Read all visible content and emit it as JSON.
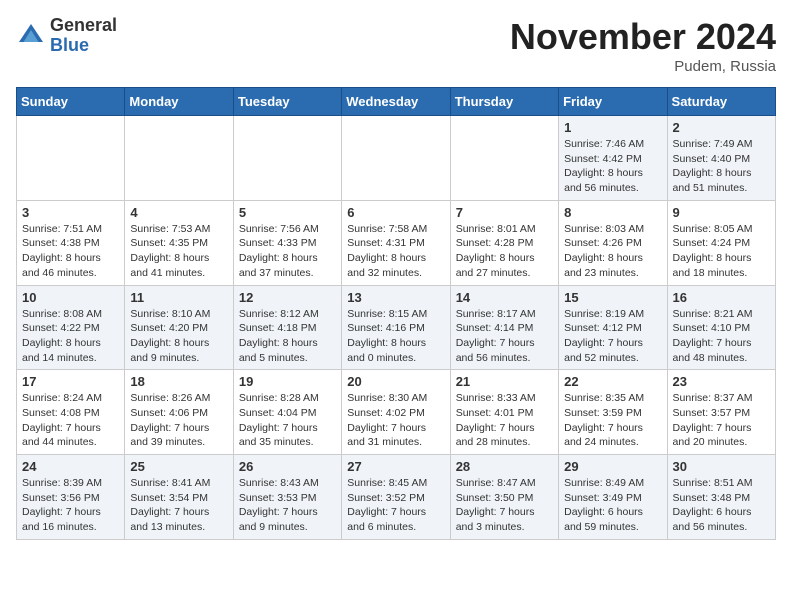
{
  "logo": {
    "general": "General",
    "blue": "Blue"
  },
  "title": "November 2024",
  "location": "Pudem, Russia",
  "days_of_week": [
    "Sunday",
    "Monday",
    "Tuesday",
    "Wednesday",
    "Thursday",
    "Friday",
    "Saturday"
  ],
  "weeks": [
    [
      {
        "day": "",
        "info": ""
      },
      {
        "day": "",
        "info": ""
      },
      {
        "day": "",
        "info": ""
      },
      {
        "day": "",
        "info": ""
      },
      {
        "day": "",
        "info": ""
      },
      {
        "day": "1",
        "info": "Sunrise: 7:46 AM\nSunset: 4:42 PM\nDaylight: 8 hours and 56 minutes."
      },
      {
        "day": "2",
        "info": "Sunrise: 7:49 AM\nSunset: 4:40 PM\nDaylight: 8 hours and 51 minutes."
      }
    ],
    [
      {
        "day": "3",
        "info": "Sunrise: 7:51 AM\nSunset: 4:38 PM\nDaylight: 8 hours and 46 minutes."
      },
      {
        "day": "4",
        "info": "Sunrise: 7:53 AM\nSunset: 4:35 PM\nDaylight: 8 hours and 41 minutes."
      },
      {
        "day": "5",
        "info": "Sunrise: 7:56 AM\nSunset: 4:33 PM\nDaylight: 8 hours and 37 minutes."
      },
      {
        "day": "6",
        "info": "Sunrise: 7:58 AM\nSunset: 4:31 PM\nDaylight: 8 hours and 32 minutes."
      },
      {
        "day": "7",
        "info": "Sunrise: 8:01 AM\nSunset: 4:28 PM\nDaylight: 8 hours and 27 minutes."
      },
      {
        "day": "8",
        "info": "Sunrise: 8:03 AM\nSunset: 4:26 PM\nDaylight: 8 hours and 23 minutes."
      },
      {
        "day": "9",
        "info": "Sunrise: 8:05 AM\nSunset: 4:24 PM\nDaylight: 8 hours and 18 minutes."
      }
    ],
    [
      {
        "day": "10",
        "info": "Sunrise: 8:08 AM\nSunset: 4:22 PM\nDaylight: 8 hours and 14 minutes."
      },
      {
        "day": "11",
        "info": "Sunrise: 8:10 AM\nSunset: 4:20 PM\nDaylight: 8 hours and 9 minutes."
      },
      {
        "day": "12",
        "info": "Sunrise: 8:12 AM\nSunset: 4:18 PM\nDaylight: 8 hours and 5 minutes."
      },
      {
        "day": "13",
        "info": "Sunrise: 8:15 AM\nSunset: 4:16 PM\nDaylight: 8 hours and 0 minutes."
      },
      {
        "day": "14",
        "info": "Sunrise: 8:17 AM\nSunset: 4:14 PM\nDaylight: 7 hours and 56 minutes."
      },
      {
        "day": "15",
        "info": "Sunrise: 8:19 AM\nSunset: 4:12 PM\nDaylight: 7 hours and 52 minutes."
      },
      {
        "day": "16",
        "info": "Sunrise: 8:21 AM\nSunset: 4:10 PM\nDaylight: 7 hours and 48 minutes."
      }
    ],
    [
      {
        "day": "17",
        "info": "Sunrise: 8:24 AM\nSunset: 4:08 PM\nDaylight: 7 hours and 44 minutes."
      },
      {
        "day": "18",
        "info": "Sunrise: 8:26 AM\nSunset: 4:06 PM\nDaylight: 7 hours and 39 minutes."
      },
      {
        "day": "19",
        "info": "Sunrise: 8:28 AM\nSunset: 4:04 PM\nDaylight: 7 hours and 35 minutes."
      },
      {
        "day": "20",
        "info": "Sunrise: 8:30 AM\nSunset: 4:02 PM\nDaylight: 7 hours and 31 minutes."
      },
      {
        "day": "21",
        "info": "Sunrise: 8:33 AM\nSunset: 4:01 PM\nDaylight: 7 hours and 28 minutes."
      },
      {
        "day": "22",
        "info": "Sunrise: 8:35 AM\nSunset: 3:59 PM\nDaylight: 7 hours and 24 minutes."
      },
      {
        "day": "23",
        "info": "Sunrise: 8:37 AM\nSunset: 3:57 PM\nDaylight: 7 hours and 20 minutes."
      }
    ],
    [
      {
        "day": "24",
        "info": "Sunrise: 8:39 AM\nSunset: 3:56 PM\nDaylight: 7 hours and 16 minutes."
      },
      {
        "day": "25",
        "info": "Sunrise: 8:41 AM\nSunset: 3:54 PM\nDaylight: 7 hours and 13 minutes."
      },
      {
        "day": "26",
        "info": "Sunrise: 8:43 AM\nSunset: 3:53 PM\nDaylight: 7 hours and 9 minutes."
      },
      {
        "day": "27",
        "info": "Sunrise: 8:45 AM\nSunset: 3:52 PM\nDaylight: 7 hours and 6 minutes."
      },
      {
        "day": "28",
        "info": "Sunrise: 8:47 AM\nSunset: 3:50 PM\nDaylight: 7 hours and 3 minutes."
      },
      {
        "day": "29",
        "info": "Sunrise: 8:49 AM\nSunset: 3:49 PM\nDaylight: 6 hours and 59 minutes."
      },
      {
        "day": "30",
        "info": "Sunrise: 8:51 AM\nSunset: 3:48 PM\nDaylight: 6 hours and 56 minutes."
      }
    ]
  ]
}
